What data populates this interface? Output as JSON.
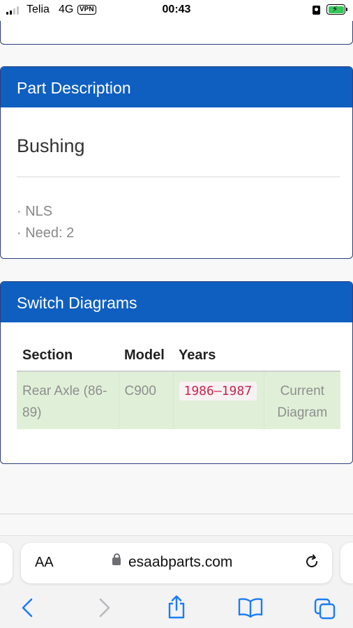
{
  "status_bar": {
    "carrier": "Telia",
    "network": "4G",
    "vpn": "VPN",
    "time": "00:43",
    "battery_state": "charging"
  },
  "part_description": {
    "header": "Part Description",
    "name": "Bushing",
    "notes": [
      "· NLS",
      "· Need: 2"
    ]
  },
  "switch_diagrams": {
    "header": "Switch Diagrams",
    "columns": [
      "Section",
      "Model",
      "Years",
      ""
    ],
    "rows": [
      {
        "section": "Rear Axle (86-89)",
        "model": "C900",
        "years": "1986–1987",
        "status": "Current Diagram"
      }
    ]
  },
  "browser": {
    "text_size_label": "AA",
    "domain": "esaabparts.com"
  },
  "colors": {
    "header_blue": "#0f5fc0",
    "row_green": "#e0f0d8",
    "accent_blue": "#1a7cf5",
    "code_red": "#c7254e"
  }
}
